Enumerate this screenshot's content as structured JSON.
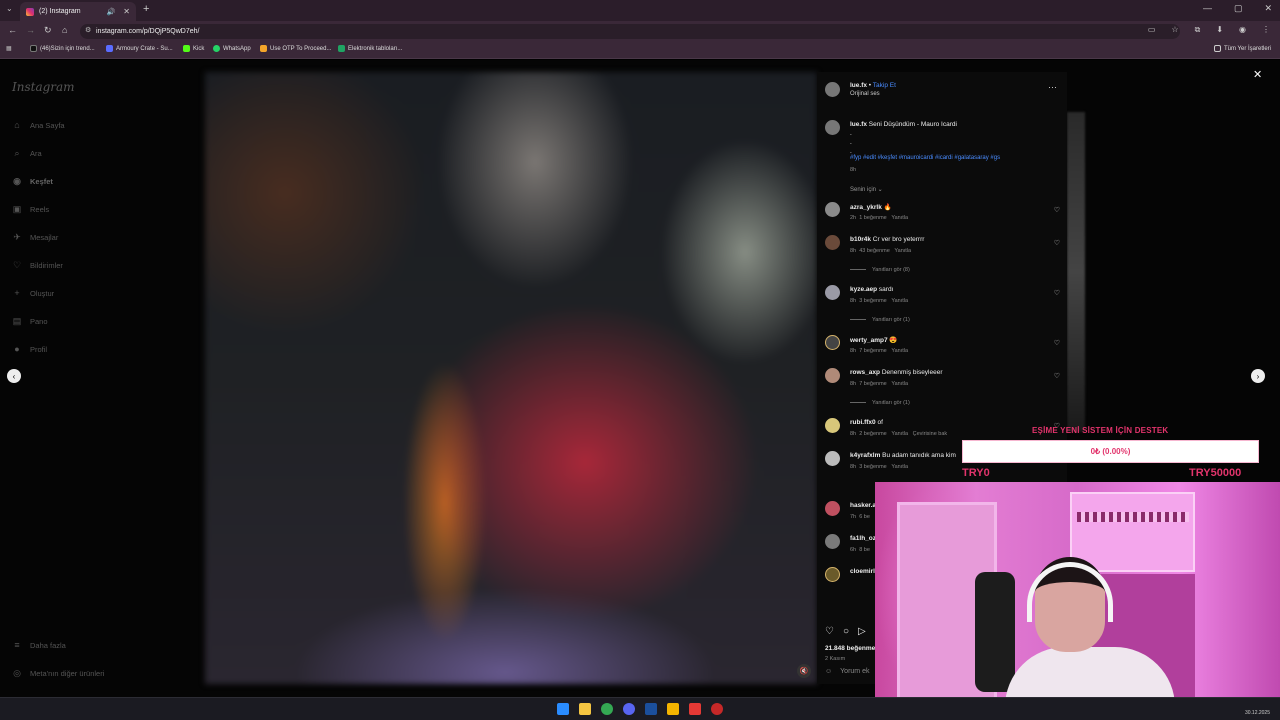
{
  "browser": {
    "tab_title": "(2) Instagram",
    "url": "instagram.com/p/DQjP5QwD7eh/",
    "bookmarks": [
      "(46)Sizin için trend...",
      "Armoury Crate - Su...",
      "Kick",
      "WhatsApp",
      "Use OTP To Proceed...",
      "Elektronik tabloları..."
    ],
    "all_bookmarks_label": "Tüm Yer İşaretleri"
  },
  "sidebar": {
    "logo": "Instagram",
    "items": [
      {
        "icon": "home-icon",
        "label": "Ana Sayfa"
      },
      {
        "icon": "search-icon",
        "label": "Ara"
      },
      {
        "icon": "compass-icon",
        "label": "Keşfet"
      },
      {
        "icon": "reels-icon",
        "label": "Reels"
      },
      {
        "icon": "messages-icon",
        "label": "Mesajlar"
      },
      {
        "icon": "heart-icon",
        "label": "Bildirimler"
      },
      {
        "icon": "plus-icon",
        "label": "Oluştur"
      },
      {
        "icon": "dashboard-icon",
        "label": "Pano"
      },
      {
        "icon": "profile-icon",
        "label": "Profil"
      }
    ],
    "more": "Daha fazla",
    "meta": "Meta'nın diğer ürünleri"
  },
  "post": {
    "author": "lue.fx",
    "follow": "Takip Et",
    "audio": "Orijinal ses",
    "caption_author": "lue.fx",
    "caption_text": "Seni Düşündüm - Mauro Icardi",
    "caption_dot": ".",
    "hashtags": "#fyp #edit #keşfet #mauroicardi #icardi #galatasaray #gs",
    "caption_time": "8h",
    "sort_label": "Senin için ⌄",
    "likes": "21.848 beğenme",
    "date": "2 Kasım",
    "comment_placeholder": "Yorum ek"
  },
  "comments": [
    {
      "user": "azra_ykrlk",
      "text": "🔥",
      "time": "2h",
      "likes": "1 beğenme",
      "reply": "Yanıtla",
      "replies": ""
    },
    {
      "user": "b10r4k",
      "text": "Cr ver bro yeterrrr",
      "time": "8h",
      "likes": "43 beğenme",
      "reply": "Yanıtla",
      "replies": "Yanıtları gör (8)"
    },
    {
      "user": "kyze.aep",
      "text": "sardı",
      "time": "8h",
      "likes": "3 beğenme",
      "reply": "Yanıtla",
      "replies": "Yanıtları gör (1)"
    },
    {
      "user": "werty_amp7",
      "text": "😍",
      "time": "8h",
      "likes": "7 beğenme",
      "reply": "Yanıtla",
      "replies": ""
    },
    {
      "user": "rows_axp",
      "text": "Denenmiş biseyleeer",
      "time": "8h",
      "likes": "7 beğenme",
      "reply": "Yanıtla",
      "replies": "Yanıtları gör (1)"
    },
    {
      "user": "rubi.ffx0",
      "text": "of",
      "time": "8h",
      "likes": "2 beğenme",
      "reply": "Yanıtla",
      "extra": "Çevirisine bak",
      "replies": ""
    },
    {
      "user": "k4yrafxlm",
      "text": "Bu adam tanıdık ama kim",
      "time": "8h",
      "likes": "3 beğenme",
      "reply": "Yanıtla",
      "replies": ""
    },
    {
      "user": "hasker.a",
      "text": "",
      "time": "7h",
      "likes": "6 be",
      "reply": "",
      "replies": ""
    },
    {
      "user": "fa1lh_oz",
      "text": "",
      "time": "6h",
      "likes": "8 be",
      "reply": "",
      "replies": ""
    },
    {
      "user": "cloemirl",
      "text": "",
      "time": "",
      "likes": "",
      "reply": "",
      "replies": ""
    }
  ],
  "stream": {
    "donate_title": "EŞİME YENİ SİSTEM İÇİN DESTEK",
    "progress_label": "0₺ (0.00%)",
    "progress_fraction": 0.0,
    "min_label": "TRY0",
    "max_label": "TRY50000"
  },
  "taskbar": {
    "clock": "30.12.2025"
  },
  "colors": {
    "accent_pink": "#e2346c",
    "link_blue": "#4a8cff"
  }
}
